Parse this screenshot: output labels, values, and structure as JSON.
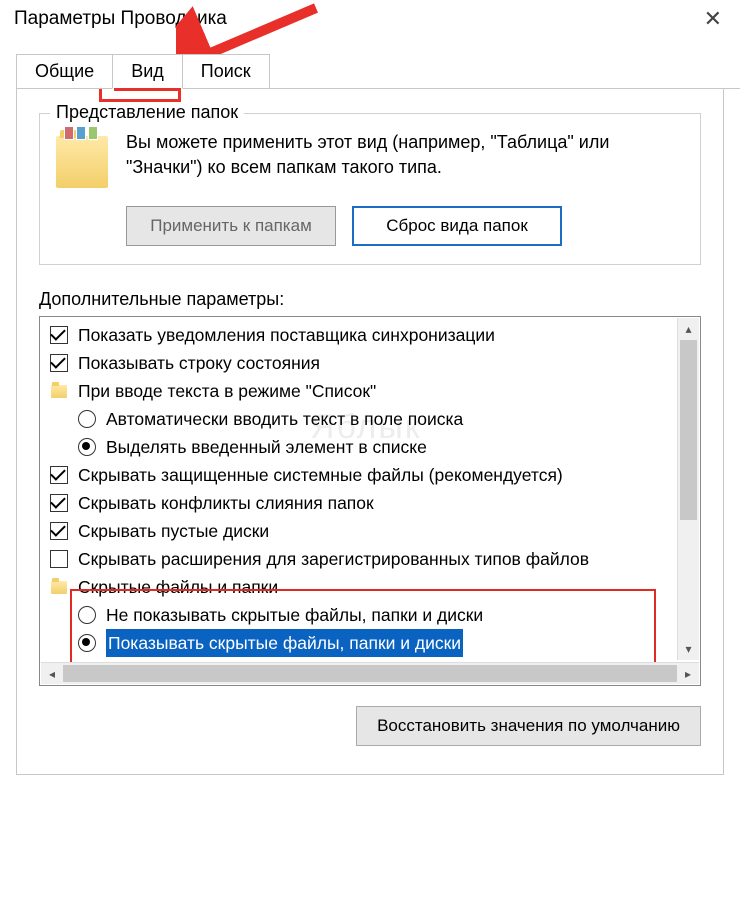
{
  "window": {
    "title": "Параметры Проводника"
  },
  "tabs": {
    "general": "Общие",
    "view": "Вид",
    "search": "Поиск"
  },
  "group": {
    "legend": "Представление папок",
    "desc": "Вы можете применить этот вид (например, \"Таблица\" или \"Значки\") ко всем папкам такого типа.",
    "apply_btn": "Применить к папкам",
    "apply_mnemonic": "к",
    "reset_btn": "Сброс вида папок",
    "reset_mnemonic": "С"
  },
  "advanced": {
    "label": "Дополнительные параметры:",
    "items": [
      {
        "type": "checkbox",
        "checked": true,
        "indent": 0,
        "label": "Показать уведомления поставщика синхронизации"
      },
      {
        "type": "checkbox",
        "checked": true,
        "indent": 0,
        "label": "Показывать строку состояния"
      },
      {
        "type": "folder",
        "checked": false,
        "indent": 0,
        "label": "При вводе текста в режиме \"Список\""
      },
      {
        "type": "radio",
        "checked": false,
        "indent": 1,
        "label": "Автоматически вводить текст в поле поиска"
      },
      {
        "type": "radio",
        "checked": true,
        "indent": 1,
        "label": "Выделять введенный элемент в списке"
      },
      {
        "type": "checkbox",
        "checked": true,
        "indent": 0,
        "label": "Скрывать защищенные системные файлы (рекомендуется)"
      },
      {
        "type": "checkbox",
        "checked": true,
        "indent": 0,
        "label": "Скрывать конфликты слияния папок"
      },
      {
        "type": "checkbox",
        "checked": true,
        "indent": 0,
        "label": "Скрывать пустые диски"
      },
      {
        "type": "checkbox",
        "checked": false,
        "indent": 0,
        "label": "Скрывать расширения для зарегистрированных типов файлов"
      },
      {
        "type": "folder",
        "checked": false,
        "indent": 0,
        "label": "Скрытые файлы и папки"
      },
      {
        "type": "radio",
        "checked": false,
        "indent": 1,
        "label": "Не показывать скрытые файлы, папки и диски"
      },
      {
        "type": "radio",
        "checked": true,
        "indent": 1,
        "label": "Показывать скрытые файлы, папки и диски",
        "highlighted": true
      }
    ]
  },
  "restore_btn": "Восстановить значения по умолчанию",
  "watermark": "Яблык"
}
